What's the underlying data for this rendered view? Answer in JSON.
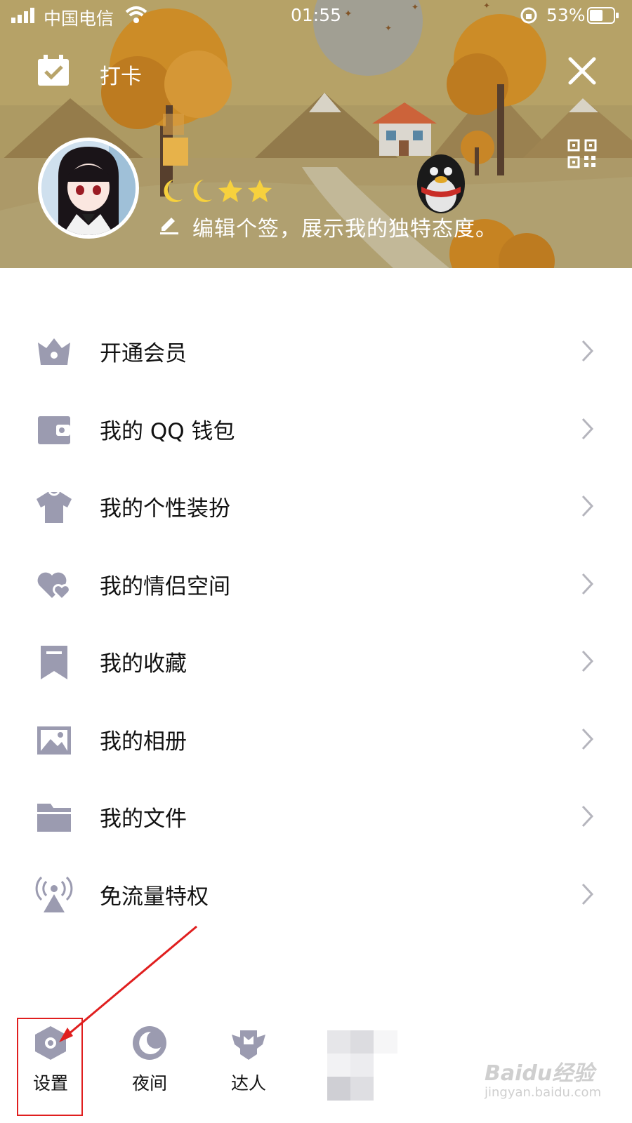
{
  "status_bar": {
    "carrier": "中国电信",
    "time": "01:55",
    "battery": "53%"
  },
  "header": {
    "checkin_label": "打卡",
    "signature": "编辑个签，展示我的独特态度。",
    "level_icons": [
      "moon-icon",
      "moon-icon",
      "star-icon",
      "star-icon"
    ]
  },
  "menu": {
    "items": [
      {
        "label": "开通会员",
        "icon": "crown-icon"
      },
      {
        "label": "我的 QQ 钱包",
        "icon": "wallet-icon"
      },
      {
        "label": "我的个性装扮",
        "icon": "shirt-icon"
      },
      {
        "label": "我的情侣空间",
        "icon": "hearts-icon"
      },
      {
        "label": "我的收藏",
        "icon": "bookmark-icon"
      },
      {
        "label": "我的相册",
        "icon": "photo-icon"
      },
      {
        "label": "我的文件",
        "icon": "folder-icon"
      },
      {
        "label": "免流量特权",
        "icon": "broadcast-tower-icon"
      }
    ]
  },
  "bottom_bar": {
    "settings_label": "设置",
    "night_label": "夜间",
    "expert_label": "达人"
  },
  "watermark": {
    "brand": "Baidu经验",
    "url": "jingyan.baidu.com"
  },
  "colors": {
    "icon_gray": "#9b9bb0",
    "highlight_red": "#e01f1f",
    "banner_sky": "#b9a566"
  }
}
